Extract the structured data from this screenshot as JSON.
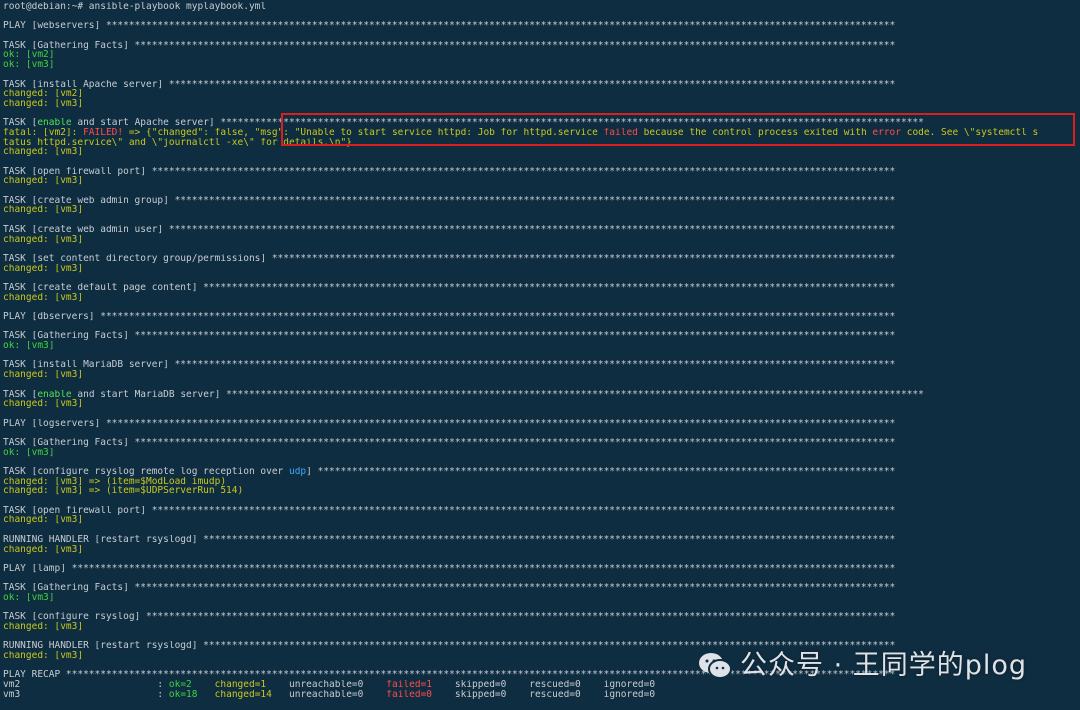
{
  "lines": [
    [
      {
        "t": "root@debian:~# ansible-playbook myplaybook.yml",
        "c": "c-white"
      }
    ],
    [],
    [
      {
        "t": "PLAY [webservers] ******************************************************************************************************************************************",
        "c": "c-gray"
      }
    ],
    [],
    [
      {
        "t": "TASK [Gathering Facts] *************************************************************************************************************************************",
        "c": "c-gray"
      }
    ],
    [
      {
        "t": "ok: [vm2]",
        "c": "c-ok"
      }
    ],
    [
      {
        "t": "ok: [vm3]",
        "c": "c-ok"
      }
    ],
    [],
    [
      {
        "t": "TASK [install Apache server] *******************************************************************************************************************************",
        "c": "c-gray"
      }
    ],
    [
      {
        "t": "changed: [vm2]",
        "c": "c-changed"
      }
    ],
    [
      {
        "t": "changed: [vm3]",
        "c": "c-changed"
      }
    ],
    [],
    [
      {
        "t": "TASK [",
        "c": "c-gray"
      },
      {
        "t": "enable",
        "c": "c-green"
      },
      {
        "t": " and start Apache server] ***************************************************************************************************************************",
        "c": "c-gray"
      }
    ],
    [
      {
        "t": "fatal: [vm2]: ",
        "c": "c-changed"
      },
      {
        "t": "FAILED!",
        "c": "c-failed"
      },
      {
        "t": " => {\"changed\": false, \"msg\": \"Unable to start service httpd: Job for httpd.service ",
        "c": "c-changed"
      },
      {
        "t": "failed",
        "c": "c-failed"
      },
      {
        "t": " because the control process exited with ",
        "c": "c-changed"
      },
      {
        "t": "error",
        "c": "c-failed"
      },
      {
        "t": " code. See \\\"systemctl s",
        "c": "c-changed"
      }
    ],
    [
      {
        "t": "tatus httpd.service\\\" and \\\"journalctl -xe\\\" for details.\\n\"}",
        "c": "c-changed"
      }
    ],
    [
      {
        "t": "changed: [vm3]",
        "c": "c-changed"
      }
    ],
    [],
    [
      {
        "t": "TASK [open firewall port] **********************************************************************************************************************************",
        "c": "c-gray"
      }
    ],
    [
      {
        "t": "changed: [vm3]",
        "c": "c-changed"
      }
    ],
    [],
    [
      {
        "t": "TASK [create web admin group] ******************************************************************************************************************************",
        "c": "c-gray"
      }
    ],
    [
      {
        "t": "changed: [vm3]",
        "c": "c-changed"
      }
    ],
    [],
    [
      {
        "t": "TASK [create web admin user] *******************************************************************************************************************************",
        "c": "c-gray"
      }
    ],
    [
      {
        "t": "changed: [vm3]",
        "c": "c-changed"
      }
    ],
    [],
    [
      {
        "t": "TASK [set content directory group/permissions] *************************************************************************************************************",
        "c": "c-gray"
      }
    ],
    [
      {
        "t": "changed: [vm3]",
        "c": "c-changed"
      }
    ],
    [],
    [
      {
        "t": "TASK [create default page content] *************************************************************************************************************************",
        "c": "c-gray"
      }
    ],
    [
      {
        "t": "changed: [vm3]",
        "c": "c-changed"
      }
    ],
    [],
    [
      {
        "t": "PLAY [dbservers] *******************************************************************************************************************************************",
        "c": "c-gray"
      }
    ],
    [],
    [
      {
        "t": "TASK [Gathering Facts] *************************************************************************************************************************************",
        "c": "c-gray"
      }
    ],
    [
      {
        "t": "ok: [vm3]",
        "c": "c-ok"
      }
    ],
    [],
    [
      {
        "t": "TASK [install MariaDB server] ******************************************************************************************************************************",
        "c": "c-gray"
      }
    ],
    [
      {
        "t": "changed: [vm3]",
        "c": "c-changed"
      }
    ],
    [],
    [
      {
        "t": "TASK [",
        "c": "c-gray"
      },
      {
        "t": "enable",
        "c": "c-green"
      },
      {
        "t": " and start MariaDB server] **************************************************************************************************************************",
        "c": "c-gray"
      }
    ],
    [
      {
        "t": "changed: [vm3]",
        "c": "c-changed"
      }
    ],
    [],
    [
      {
        "t": "PLAY [logservers] ******************************************************************************************************************************************",
        "c": "c-gray"
      }
    ],
    [],
    [
      {
        "t": "TASK [Gathering Facts] *************************************************************************************************************************************",
        "c": "c-gray"
      }
    ],
    [
      {
        "t": "ok: [vm3]",
        "c": "c-ok"
      }
    ],
    [],
    [
      {
        "t": "TASK [configure rsyslog remote log reception over ",
        "c": "c-gray"
      },
      {
        "t": "udp",
        "c": "c-blue"
      },
      {
        "t": "] *****************************************************************************************************",
        "c": "c-gray"
      }
    ],
    [
      {
        "t": "changed: [vm3] => (item=$ModLoad imudp)",
        "c": "c-changed"
      }
    ],
    [
      {
        "t": "changed: [vm3] => (item=$UDPServerRun 514)",
        "c": "c-changed"
      }
    ],
    [],
    [
      {
        "t": "TASK [open firewall port] **********************************************************************************************************************************",
        "c": "c-gray"
      }
    ],
    [
      {
        "t": "changed: [vm3]",
        "c": "c-changed"
      }
    ],
    [],
    [
      {
        "t": "RUNNING HANDLER [restart rsyslogd] *************************************************************************************************************************",
        "c": "c-gray"
      }
    ],
    [
      {
        "t": "changed: [vm3]",
        "c": "c-changed"
      }
    ],
    [],
    [
      {
        "t": "PLAY [lamp] ************************************************************************************************************************************************",
        "c": "c-gray"
      }
    ],
    [],
    [
      {
        "t": "TASK [Gathering Facts] *************************************************************************************************************************************",
        "c": "c-gray"
      }
    ],
    [
      {
        "t": "ok: [vm3]",
        "c": "c-ok"
      }
    ],
    [],
    [
      {
        "t": "TASK [configure rsyslog] ***********************************************************************************************************************************",
        "c": "c-gray"
      }
    ],
    [
      {
        "t": "changed: [vm3]",
        "c": "c-changed"
      }
    ],
    [],
    [
      {
        "t": "RUNNING HANDLER [restart rsyslogd] *************************************************************************************************************************",
        "c": "c-gray"
      }
    ],
    [
      {
        "t": "changed: [vm3]",
        "c": "c-changed"
      }
    ],
    [],
    [
      {
        "t": "PLAY RECAP *************************************************************************************************************************************************",
        "c": "c-gray"
      }
    ],
    [
      {
        "t": "vm2                        : ",
        "c": "c-gray"
      },
      {
        "t": "ok=2",
        "c": "c-ok"
      },
      {
        "t": "    ",
        "c": "c-gray"
      },
      {
        "t": "changed=1",
        "c": "c-changed"
      },
      {
        "t": "    unreachable=0    ",
        "c": "c-gray"
      },
      {
        "t": "failed=1",
        "c": "c-failed"
      },
      {
        "t": "    skipped=0    rescued=0    ignored=0",
        "c": "c-gray"
      }
    ],
    [
      {
        "t": "vm3                        : ",
        "c": "c-gray"
      },
      {
        "t": "ok=18",
        "c": "c-ok"
      },
      {
        "t": "   ",
        "c": "c-gray"
      },
      {
        "t": "changed=14",
        "c": "c-changed"
      },
      {
        "t": "   unreachable=0    ",
        "c": "c-gray"
      },
      {
        "t": "failed=0",
        "c": "c-failed"
      },
      {
        "t": "    skipped=0    rescued=0    ignored=0",
        "c": "c-gray"
      }
    ]
  ],
  "watermark": {
    "text": "公众号 · 王同学的plog",
    "icon": "wechat-icon"
  },
  "colors": {
    "background": "#0f2d40",
    "ok": "#3fd23f",
    "changed": "#c8c81e",
    "failed": "#ff4b4b",
    "highlight": "#d92020"
  }
}
